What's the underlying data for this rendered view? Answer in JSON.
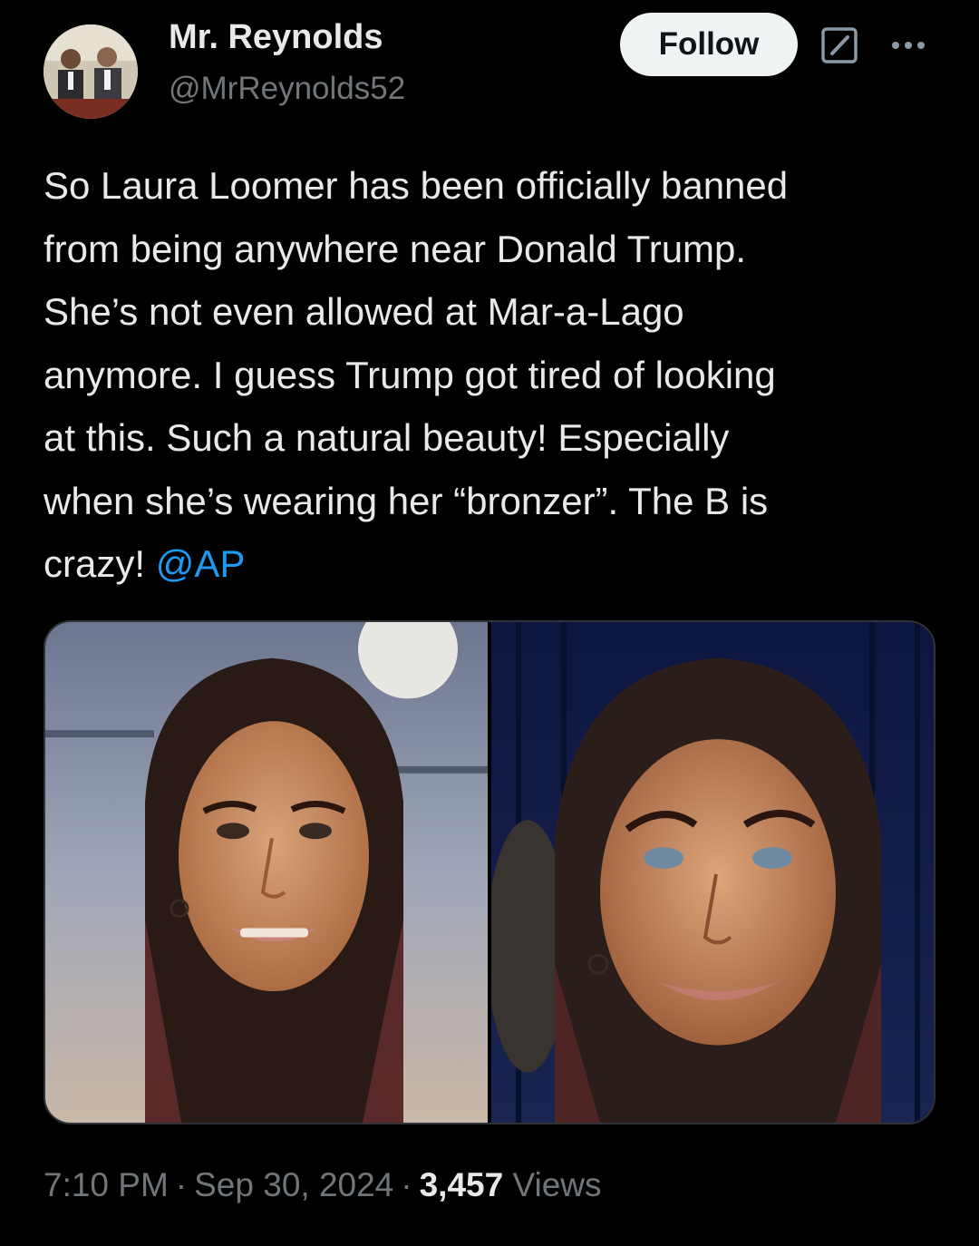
{
  "author": {
    "display_name": "Mr. Reynolds",
    "handle": "@MrReynolds52",
    "avatar_icon": "profile-photo"
  },
  "header": {
    "follow_label": "Follow",
    "grok_icon": "grok-icon",
    "more_icon": "more-options-icon"
  },
  "tweet": {
    "lines": [
      "So Laura Loomer has been officially banned",
      "from being anywhere near Donald Trump.",
      "She’s not even allowed at Mar-a-Lago",
      "anymore. I guess Trump got tired of looking",
      "at this. Such a natural beauty! Especially",
      "when she’s wearing her “bronzer”. The B is",
      "crazy!"
    ],
    "mention": "@AP"
  },
  "media": {
    "photo_count": 2
  },
  "meta": {
    "time": "7:10 PM",
    "separator": "·",
    "date": "Sep 30, 2024",
    "views_count": "3,457",
    "views_label": "Views"
  },
  "colors": {
    "background": "#000000",
    "text": "#e7e9ea",
    "secondary_text": "#71767b",
    "link": "#1d9bf0",
    "follow_button_bg": "#eff3f4"
  }
}
